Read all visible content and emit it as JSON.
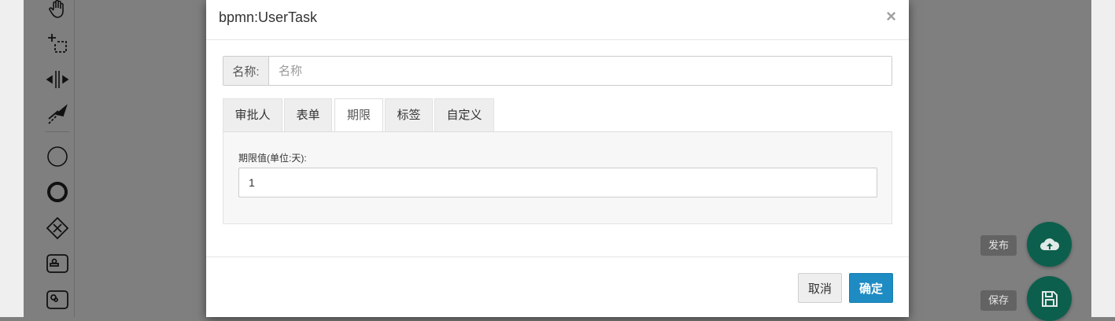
{
  "modal": {
    "title": "bpmn:UserTask",
    "close_glyph": "×",
    "name_label": "名称:",
    "name_placeholder": "名称",
    "name_value": "",
    "tabs": [
      {
        "label": "审批人",
        "active": false
      },
      {
        "label": "表单",
        "active": false
      },
      {
        "label": "期限",
        "active": true
      },
      {
        "label": "标签",
        "active": false
      },
      {
        "label": "自定义",
        "active": false
      }
    ],
    "deadline": {
      "label": "期限值(单位:天):",
      "value": "1"
    },
    "footer": {
      "cancel_label": "取消",
      "ok_label": "确定"
    }
  },
  "palette": {
    "tools": [
      "hand-tool-icon",
      "lasso-tool-icon",
      "space-tool-icon",
      "global-connect-icon",
      "start-event-icon",
      "end-event-icon",
      "gateway-icon",
      "task-icon",
      "subprocess-icon"
    ]
  },
  "actions": {
    "publish_label": "发布",
    "save_label": "保存"
  },
  "colors": {
    "primary": "#1e8bc3",
    "fab": "#0d5f4d",
    "backdrop": "#7f7f7f"
  }
}
